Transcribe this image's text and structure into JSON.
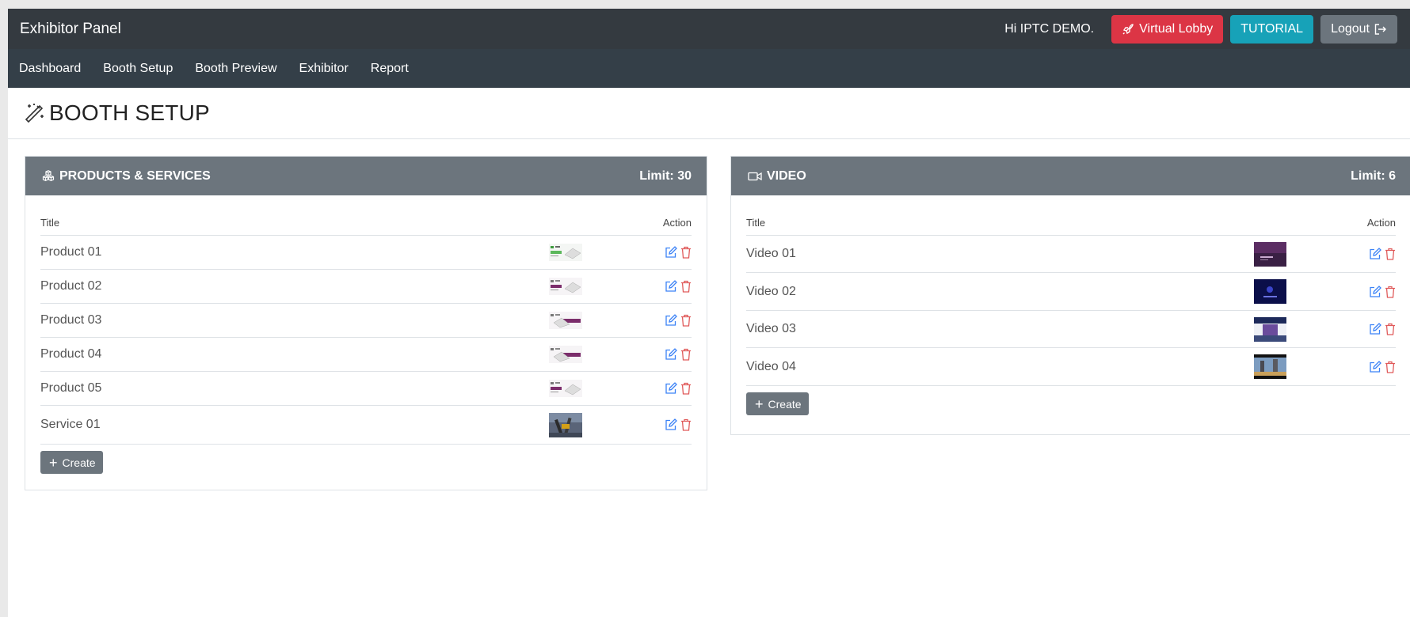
{
  "header": {
    "brand": "Exhibitor Panel",
    "greeting": "Hi IPTC DEMO.",
    "virtual_lobby": "Virtual Lobby",
    "tutorial": "TUTORIAL",
    "logout": "Logout"
  },
  "nav": [
    "Dashboard",
    "Booth Setup",
    "Booth Preview",
    "Exhibitor",
    "Report"
  ],
  "page": {
    "title": "BOOTH SETUP"
  },
  "products": {
    "title": "PRODUCTS & SERVICES",
    "limit": "Limit: 30",
    "col_title": "Title",
    "col_action": "Action",
    "items": [
      {
        "title": "Product 01",
        "thumb": "green-banner"
      },
      {
        "title": "Product 02",
        "thumb": "purple-banner"
      },
      {
        "title": "Product 03",
        "thumb": "purple-banner"
      },
      {
        "title": "Product 04",
        "thumb": "purple-banner"
      },
      {
        "title": "Product 05",
        "thumb": "purple-banner"
      },
      {
        "title": "Service 01",
        "thumb": "photo"
      }
    ],
    "create": "Create"
  },
  "video": {
    "title": "VIDEO",
    "limit": "Limit: 6",
    "col_title": "Title",
    "col_action": "Action",
    "items": [
      {
        "title": "Video 01",
        "thumb": "purple-frame"
      },
      {
        "title": "Video 02",
        "thumb": "dark-blue-frame"
      },
      {
        "title": "Video 03",
        "thumb": "stage-frame"
      },
      {
        "title": "Video 04",
        "thumb": "city-frame"
      }
    ],
    "create": "Create"
  },
  "colors": {
    "topbar": "#343a40",
    "navbar": "#343f48",
    "card_header": "#6c757d",
    "danger": "#dc3545",
    "info": "#17a2b8",
    "edit_icon": "#3b82f6",
    "delete_icon": "#e05a5a"
  }
}
